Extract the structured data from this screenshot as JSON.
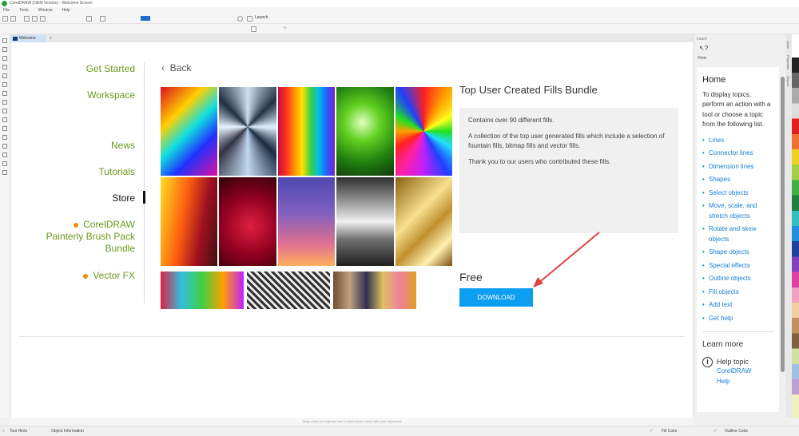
{
  "window": {
    "title": "CorelDRAW (OEM Version) - Welcome Screen"
  },
  "menu": [
    "File",
    "Tools",
    "Window",
    "Help"
  ],
  "toolbar": {
    "launch_label": "Launch"
  },
  "tab": {
    "label": "Welcome Screen"
  },
  "nav": {
    "get_started": "Get Started",
    "workspace": "Workspace",
    "news": "News",
    "tutorials": "Tutorials",
    "store": "Store",
    "item1": "CorelDRAW Painterly Brush Pack Bundle",
    "item2": "Vector FX"
  },
  "back_label": "Back",
  "product": {
    "title": "Top User Created Fills Bundle",
    "desc1": "Contains over 90 different fills.",
    "desc2": "A collection of the top user generated fills which include a selection of fountain fills, bitmap fills and vector fills.",
    "desc3": "Thank you to our users who contributed these fills.",
    "price": "Free",
    "download_label": "DOWNLOAD"
  },
  "learn": {
    "header": "Learn",
    "hints_label": "Hints",
    "home": "Home",
    "intro": "To display topics, perform an action with a tool or choose a topic from the following list.",
    "topics": [
      "Lines",
      "Connector lines",
      "Dimension lines",
      "Shapes",
      "Select objects",
      "Move, scale, and stretch objects",
      "Rotate and skew objects",
      "Shape objects",
      "Special effects",
      "Outline objects",
      "Fill objects",
      "Add text",
      "Get help"
    ],
    "learn_more": "Learn more",
    "help_topic": "Help topic",
    "help_link": "CorelDRAW Help"
  },
  "side_tabs": [
    "Learn",
    "Properties",
    "Objects"
  ],
  "bottom_hint": "Drag colors (or objects) here to store these colors with your document",
  "status": {
    "tool_hints": "Tool Hints",
    "object_info": "Object Information",
    "fill_color": "Fill Color",
    "outline_color": "Outline Color"
  },
  "colors": {
    "accent": "#0e9ef0",
    "nav_green": "#6a9a1c",
    "link": "#1a7fd0"
  }
}
